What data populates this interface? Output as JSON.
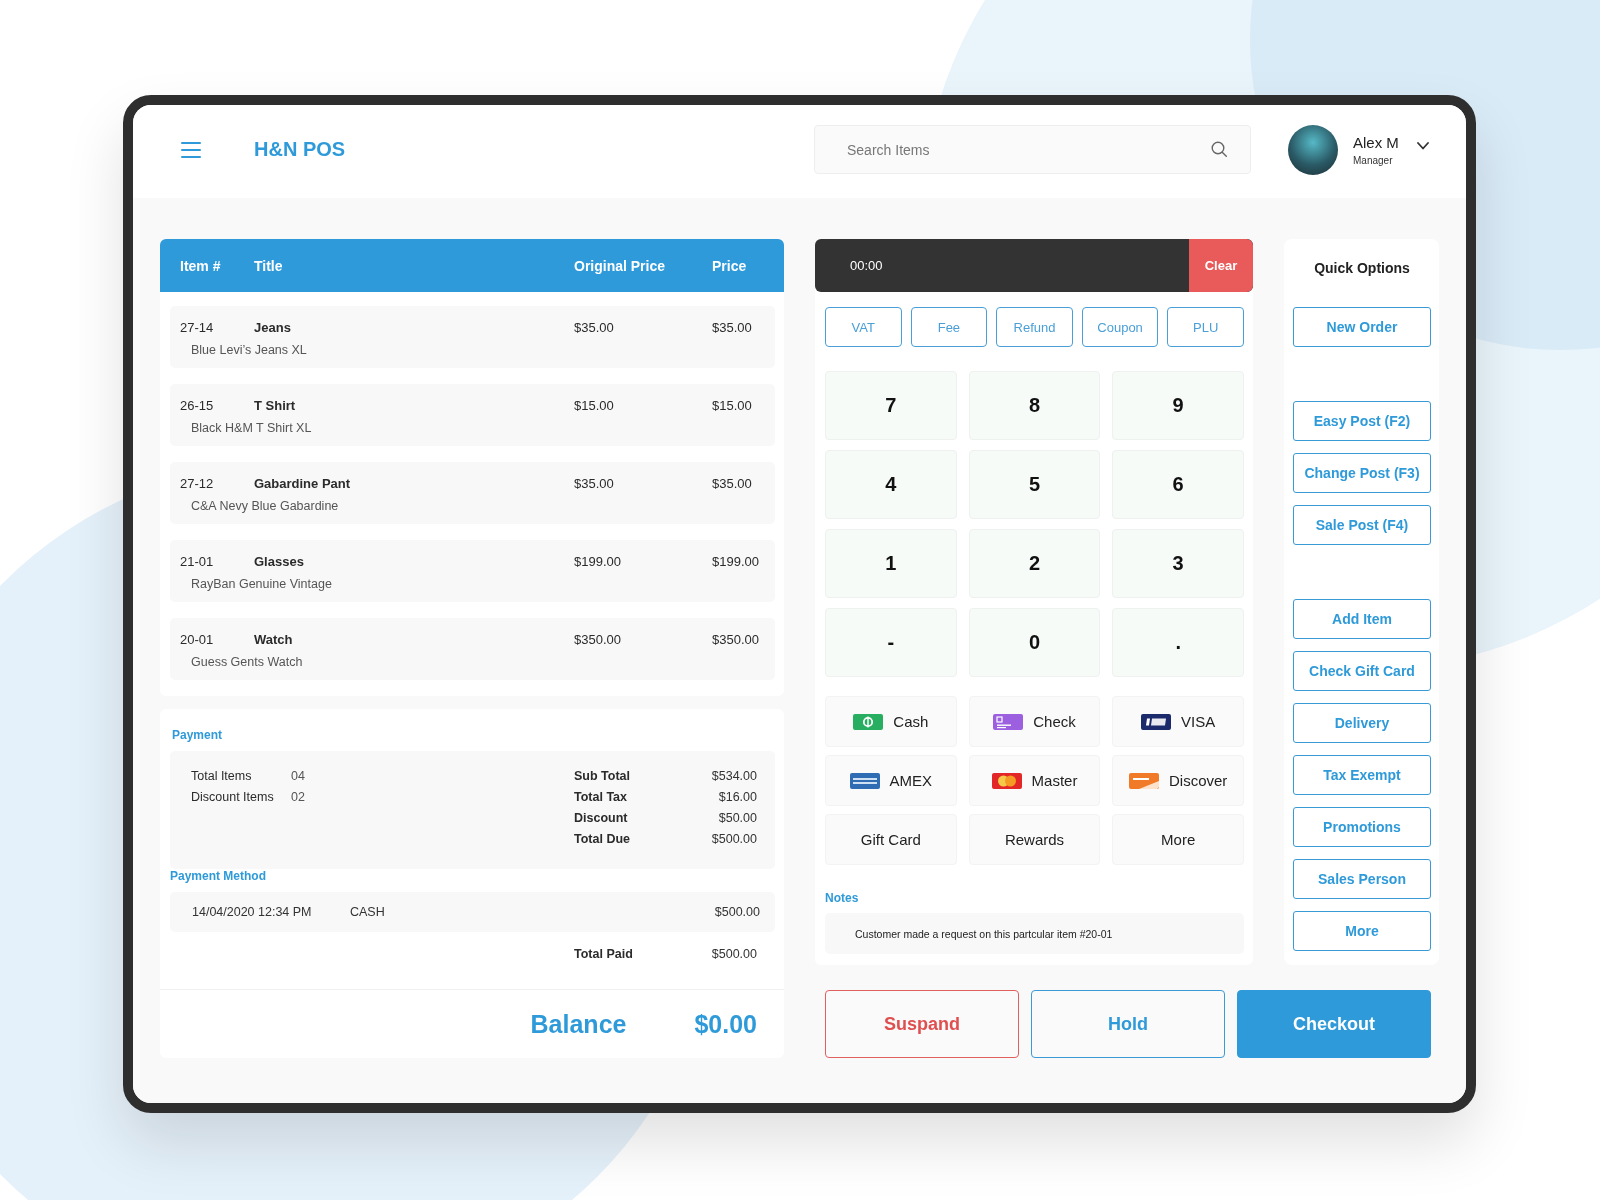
{
  "app": {
    "title": "H&N POS"
  },
  "header": {
    "search": {
      "placeholder": "Search Items"
    },
    "user": {
      "name": "Alex M",
      "role": "Manager"
    }
  },
  "order_table": {
    "columns": [
      "Item #",
      "Title",
      "Original Price",
      "Price"
    ],
    "rows": [
      {
        "item": "27-14",
        "title": "Jeans",
        "description": "Blue Levi’s Jeans XL",
        "original_price": "$35.00",
        "price": "$35.00"
      },
      {
        "item": "26-15",
        "title": "T Shirt",
        "description": "Black H&M T Shirt XL",
        "original_price": "$15.00",
        "price": "$15.00"
      },
      {
        "item": "27-12",
        "title": "Gabardine Pant",
        "description": "C&A Nevy Blue Gabardine",
        "original_price": "$35.00",
        "price": "$35.00"
      },
      {
        "item": "21-01",
        "title": "Glasses",
        "description": "RayBan Genuine Vintage",
        "original_price": "$199.00",
        "price": "$199.00"
      },
      {
        "item": "20-01",
        "title": "Watch",
        "description": "Guess Gents Watch",
        "original_price": "$350.00",
        "price": "$350.00"
      }
    ]
  },
  "payment": {
    "title": "Payment",
    "counts": [
      {
        "label": "Total Items",
        "value": "04"
      },
      {
        "label": "Discount Items",
        "value": "02"
      }
    ],
    "totals": [
      {
        "label": "Sub Total",
        "value": "$534.00"
      },
      {
        "label": "Total Tax",
        "value": "$16.00"
      },
      {
        "label": "Discount",
        "value": "$50.00"
      },
      {
        "label": "Total Due",
        "value": "$500.00"
      }
    ],
    "method_title": "Payment Method",
    "methods": [
      {
        "date": "14/04/2020 12:34 PM",
        "type": "CASH",
        "amount": "$500.00"
      }
    ],
    "total_paid": {
      "label": "Total Paid",
      "value": "$500.00"
    },
    "balance": {
      "label": "Balance",
      "value": "$0.00"
    }
  },
  "register": {
    "display": "00:00",
    "clear_button": "Clear",
    "modifiers": [
      "VAT",
      "Fee",
      "Refund",
      "Coupon",
      "PLU"
    ],
    "keys": [
      "7",
      "8",
      "9",
      "4",
      "5",
      "6",
      "1",
      "2",
      "3",
      "-",
      "0",
      "."
    ],
    "tenders": [
      {
        "kind": "cash",
        "label": "Cash"
      },
      {
        "kind": "check",
        "label": "Check"
      },
      {
        "kind": "visa",
        "label": "VISA"
      },
      {
        "kind": "amex",
        "label": "AMEX"
      },
      {
        "kind": "master",
        "label": "Master"
      },
      {
        "kind": "discover",
        "label": "Discover"
      },
      {
        "kind": "plain",
        "label": "Gift Card"
      },
      {
        "kind": "plain",
        "label": "Rewards"
      },
      {
        "kind": "plain",
        "label": "More"
      }
    ],
    "notes": {
      "title": "Notes",
      "text": "Customer made a request on this partcular item #20-01"
    }
  },
  "quick_options": {
    "title": "Quick Options",
    "groups": [
      [
        "New Order"
      ],
      [
        "Easy Post (F2)",
        "Change Post (F3)",
        "Sale Post (F4)"
      ],
      [
        "Add Item",
        "Check Gift Card",
        "Delivery",
        "Tax Exempt",
        "Promotions",
        "Sales Person",
        "More"
      ]
    ]
  },
  "actions": [
    {
      "kind": "danger",
      "label": "Suspand"
    },
    {
      "kind": "outline",
      "label": "Hold"
    },
    {
      "kind": "primary",
      "label": "Checkout"
    }
  ]
}
